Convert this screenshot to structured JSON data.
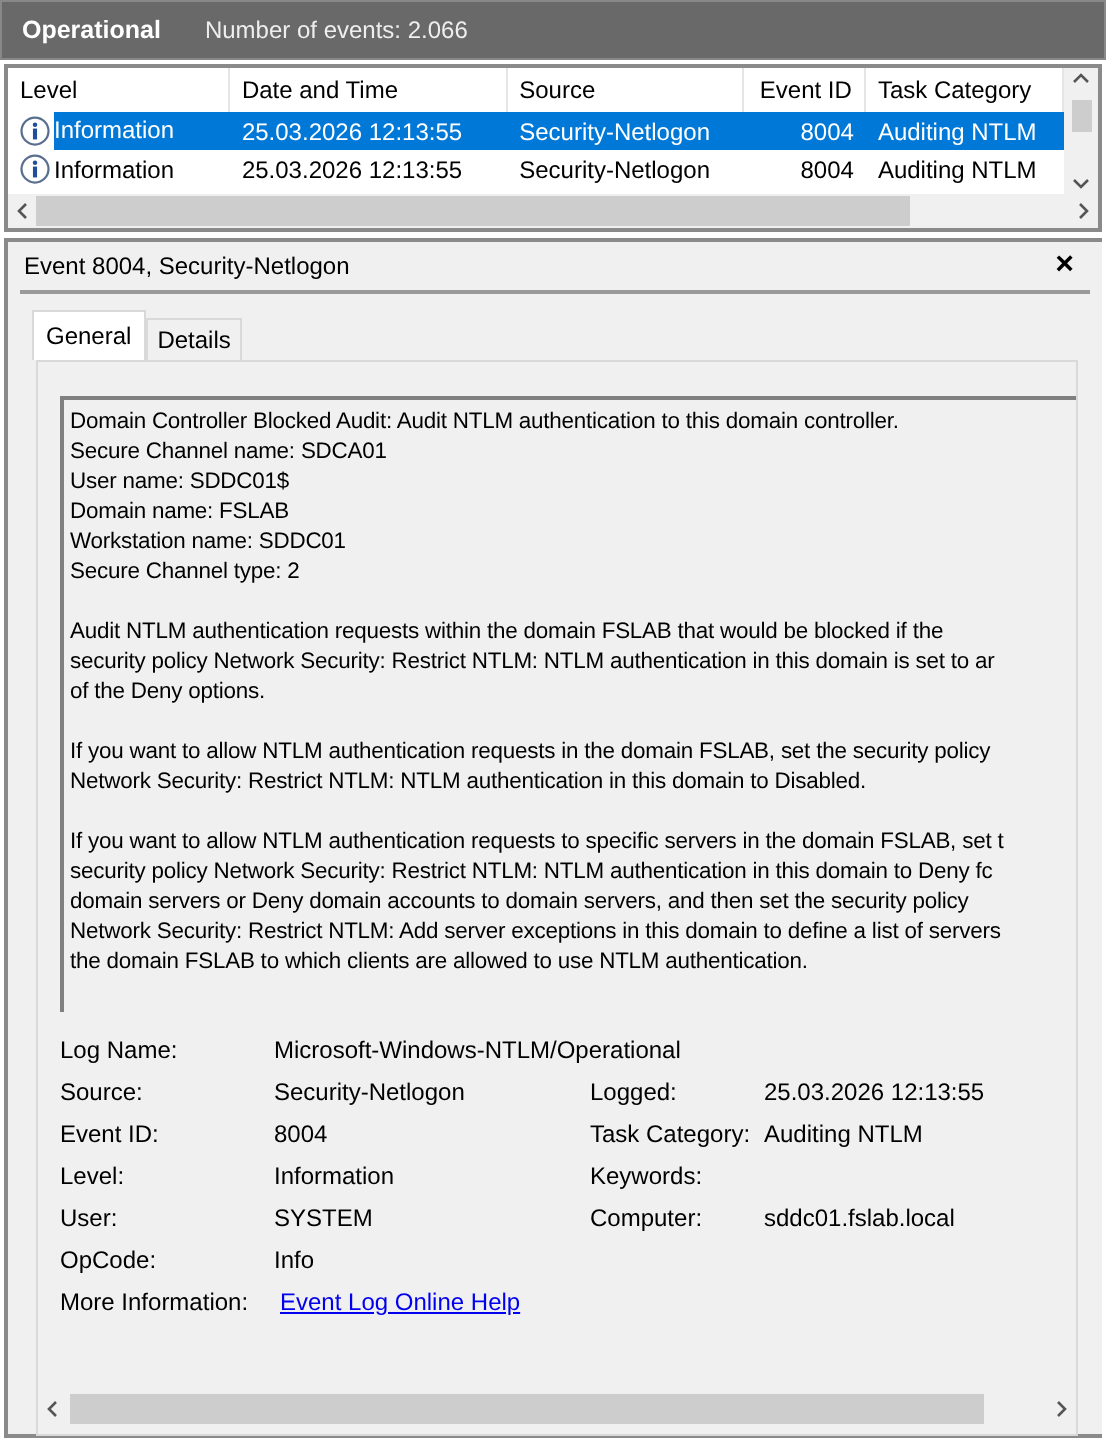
{
  "header": {
    "title": "Operational",
    "count": "Number of events: 2.066"
  },
  "table": {
    "columns": [
      "Level",
      "Date and Time",
      "Source",
      "Event ID",
      "Task Category"
    ],
    "rows": [
      {
        "level": "Information",
        "date": "25.03.2026 12:13:55",
        "source": "Security-Netlogon",
        "event_id": "8004",
        "task_category": "Auditing NTLM",
        "selected": true
      },
      {
        "level": "Information",
        "date": "25.03.2026 12:13:55",
        "source": "Security-Netlogon",
        "event_id": "8004",
        "task_category": "Auditing NTLM",
        "selected": false
      }
    ]
  },
  "detail": {
    "title": "Event 8004, Security-Netlogon",
    "close": "×",
    "tabs": [
      {
        "label": "General",
        "selected": true
      },
      {
        "label": "Details",
        "selected": false
      }
    ],
    "description": [
      [
        "Domain Controller Blocked Audit: Audit NTLM authentication to this domain controller.",
        "Secure Channel name: SDCA01",
        "User name: SDDC01$",
        "Domain name: FSLAB",
        "Workstation name: SDDC01",
        "Secure Channel type: 2"
      ],
      [
        "Audit NTLM authentication requests within the domain FSLAB that would be blocked if the",
        "security policy Network Security: Restrict NTLM: NTLM authentication in this domain is set to ar",
        "of the Deny options."
      ],
      [
        "If you want to allow NTLM authentication requests in the domain FSLAB, set the security policy",
        "Network Security: Restrict NTLM: NTLM authentication in this domain to Disabled."
      ],
      [
        "If you want to allow NTLM authentication requests to specific servers in the domain FSLAB, set t",
        "security policy Network Security: Restrict NTLM: NTLM authentication in this domain to Deny fc",
        "domain servers or Deny domain accounts to domain servers, and then set the security policy",
        "Network Security: Restrict NTLM: Add server exceptions in this domain to define a list of servers",
        "the domain FSLAB to which clients are allowed to use NTLM authentication."
      ]
    ],
    "fields": [
      {
        "label": "Log Name:",
        "value": "Microsoft-Windows-NTLM/Operational"
      },
      {
        "label": "Source:",
        "value": "Security-Netlogon",
        "label2": "Logged:",
        "value2": "25.03.2026 12:13:55"
      },
      {
        "label": "Event ID:",
        "value": "8004",
        "label2": "Task Category:",
        "value2": "Auditing NTLM"
      },
      {
        "label": "Level:",
        "value": "Information",
        "label2": "Keywords:"
      },
      {
        "label": "User:",
        "value": "SYSTEM",
        "label2": "Computer:",
        "value2": "sddc01.fslab.local"
      },
      {
        "label": "OpCode:",
        "value": "Info"
      }
    ],
    "more_info": {
      "label": "More Information:",
      "link": "Event Log Online Help"
    }
  }
}
